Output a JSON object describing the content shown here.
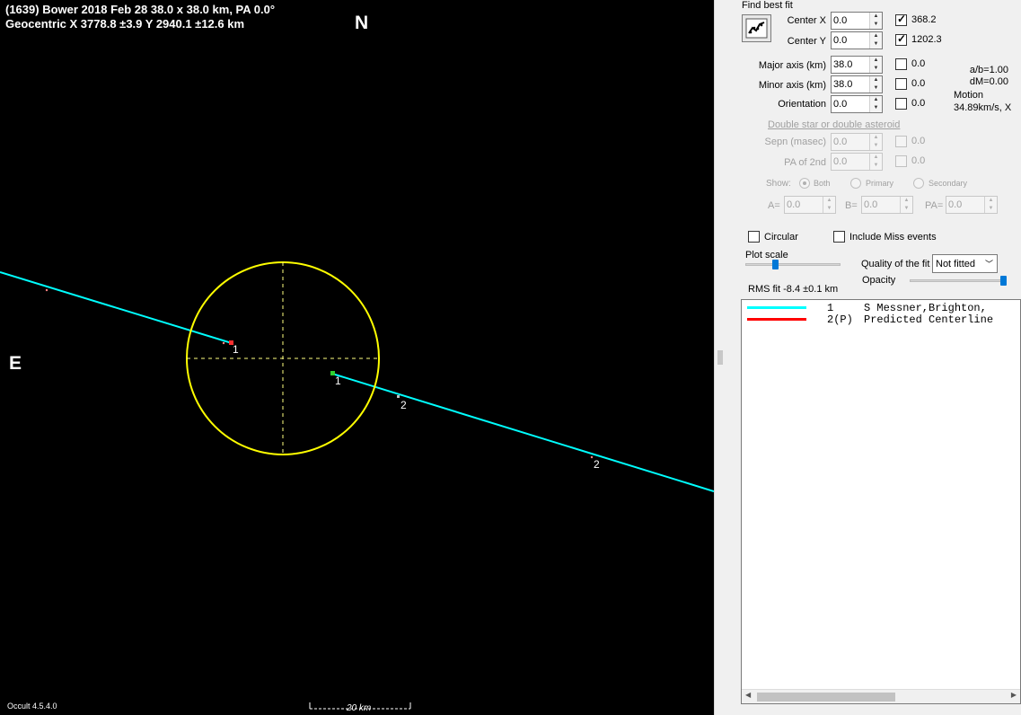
{
  "plot": {
    "header_line1": "(1639) Bower  2018 Feb 28  38.0 x 38.0 km, PA 0.0°",
    "header_line2": "Geocentric  X  3778.8 ±3.9  Y 2940.1 ±12.6 km",
    "north_label": "N",
    "east_label": "E",
    "version": "Occult 4.5.4.0",
    "scale_label": "20 km",
    "chord_labels": [
      "1",
      "1",
      "2",
      "2"
    ],
    "colors": {
      "background": "#000000",
      "ellipse": "#ffff00",
      "chord": "#00ffff",
      "disappear": "#ff3030",
      "reappear": "#30d030"
    }
  },
  "panel": {
    "find_best_fit": "Find best fit",
    "center_x": {
      "label": "Center X",
      "value": "0.0",
      "checked": true,
      "check_value": "368.2"
    },
    "center_y": {
      "label": "Center Y",
      "value": "0.0",
      "checked": true,
      "check_value": "1202.3"
    },
    "major_axis": {
      "label": "Major axis (km)",
      "value": "38.0",
      "checked": false,
      "check_value": "0.0"
    },
    "minor_axis": {
      "label": "Minor axis (km)",
      "value": "38.0",
      "checked": false,
      "check_value": "0.0"
    },
    "orientation": {
      "label": "Orientation",
      "value": "0.0",
      "checked": false,
      "check_value": "0.0"
    },
    "ab_ratio": "a/b=1.00",
    "dm": "dM=0.00",
    "motion_label": "Motion",
    "motion_value": "34.89km/s, X",
    "double_star_link": "Double star  or  double asteroid",
    "sepn": {
      "label": "Sepn (masec)",
      "value": "0.0",
      "check_value": "0.0"
    },
    "pa_2nd": {
      "label": "PA of 2nd",
      "value": "0.0",
      "check_value": "0.0"
    },
    "show_label": "Show:",
    "show_options": [
      "Both",
      "Primary",
      "Secondary"
    ],
    "a_label": "A=",
    "a_value": "0.0",
    "b_label": "B=",
    "b_value": "0.0",
    "pa_label": "PA=",
    "pa_value": "0.0",
    "circular_label": "Circular",
    "include_miss_label": "Include Miss events",
    "plot_scale_label": "Plot scale",
    "quality_label": "Quality of the fit",
    "quality_value": "Not fitted",
    "opacity_label": "Opacity",
    "rms_fit": "RMS fit -8.4 ±0.1 km",
    "plot_scale_level": 0.38,
    "opacity_level": 1.0,
    "legend": [
      {
        "num": "1",
        "text": "S Messner,Brighton,",
        "color": "#00ffff"
      },
      {
        "num": "2(P)",
        "text": "Predicted Centerline",
        "color": "#ff0000"
      }
    ]
  }
}
